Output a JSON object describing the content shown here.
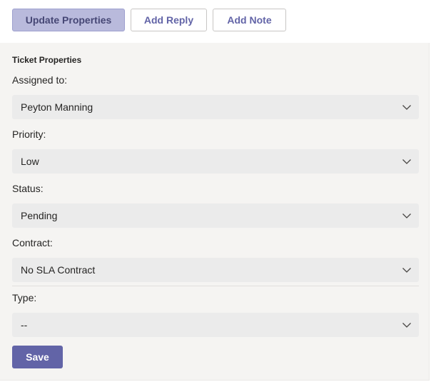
{
  "tabs": {
    "update_properties": "Update Properties",
    "add_reply": "Add Reply",
    "add_note": "Add Note"
  },
  "panel": {
    "title": "Ticket Properties"
  },
  "fields": {
    "assigned_to": {
      "label": "Assigned to:",
      "value": "Peyton Manning"
    },
    "priority": {
      "label": "Priority:",
      "value": "Low"
    },
    "status": {
      "label": "Status:",
      "value": "Pending"
    },
    "contract": {
      "label": "Contract:",
      "value": "No SLA Contract"
    },
    "type": {
      "label": "Type:",
      "value": "--"
    }
  },
  "actions": {
    "save_label": "Save"
  },
  "icons": {
    "dropdown": "chevron-down-icon"
  },
  "colors": {
    "accent": "#6264a7",
    "active_tab_bg": "#b9badc",
    "panel_bg": "#f5f4f2",
    "select_bg": "#ebebeb"
  }
}
